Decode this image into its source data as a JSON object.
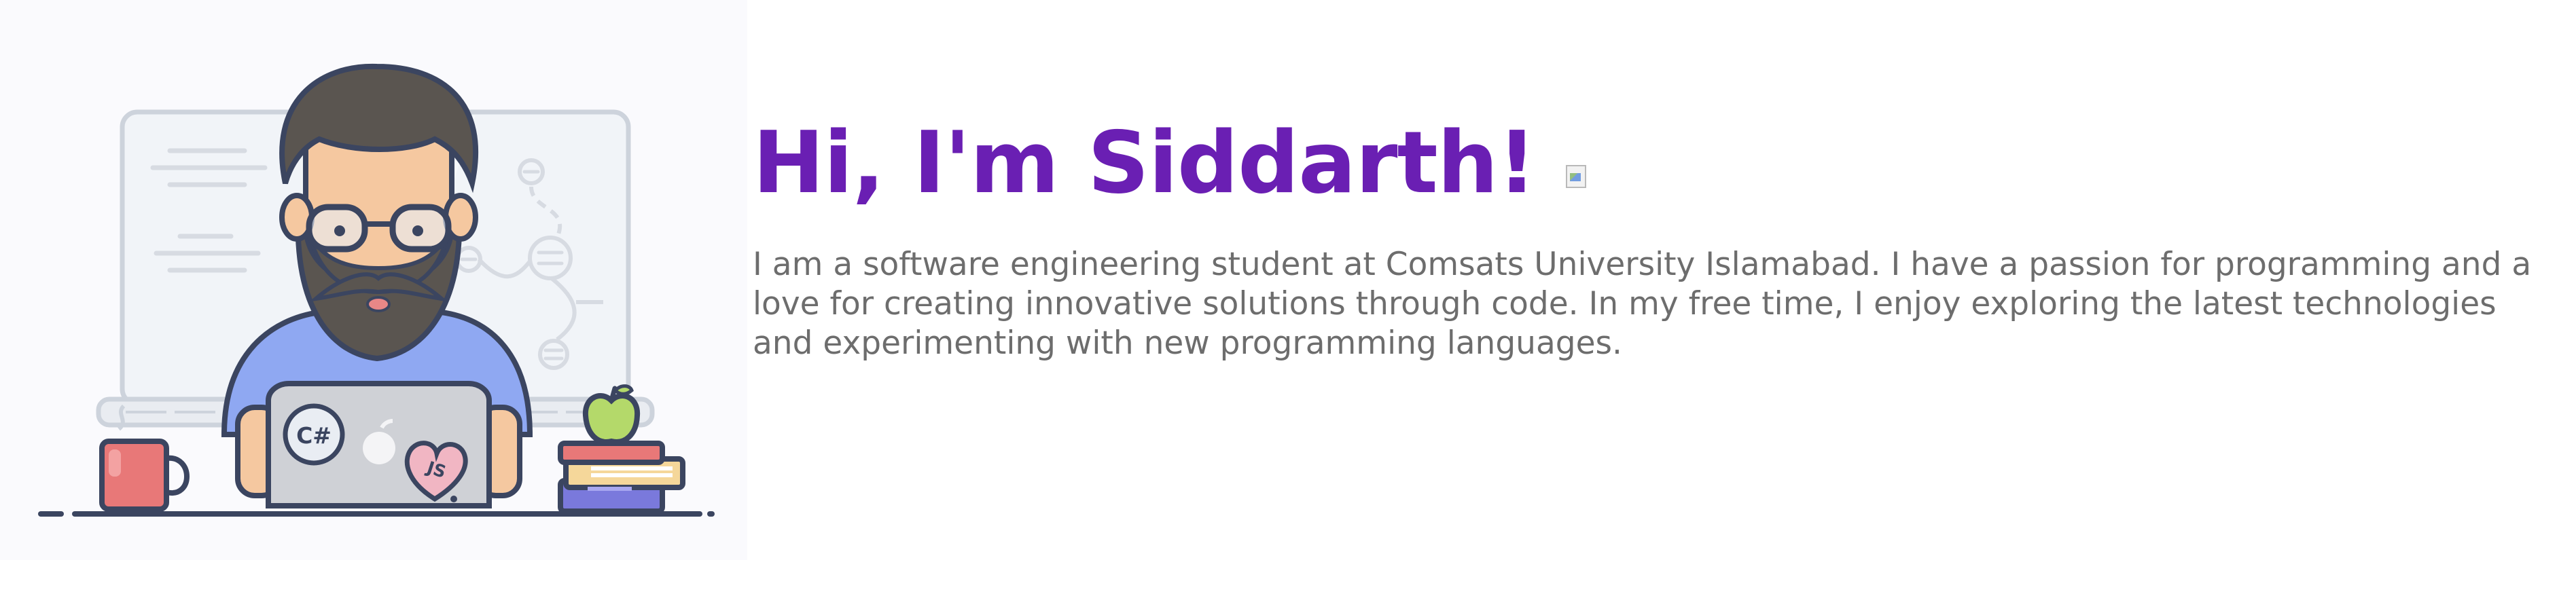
{
  "hero": {
    "title": "Hi, I'm Siddarth!",
    "wave_image": "broken-image-icon",
    "bio": "I am a software engineering student at Comsats University Islamabad. I have a passion for programming and a love for creating innovative solutions through code. In my free time, I enjoy exploring the latest technologies and experimenting with new programming languages.",
    "illustration": {
      "laptop_stickers": [
        "C#",
        "JS"
      ]
    }
  },
  "colors": {
    "title": "#6a1fb3",
    "bio": "#6d6d6d",
    "shirt": "#8fa8f2",
    "outline": "#3b4560"
  }
}
